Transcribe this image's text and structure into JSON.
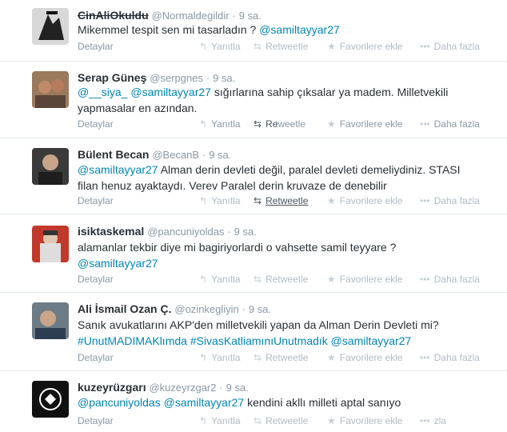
{
  "actions": {
    "details": "Detaylar",
    "reply": "Yanıtla",
    "retweet": "Retweetle",
    "favorite": "Favorilere ekle",
    "more": "Daha fazla",
    "retweet_partial": "Re",
    "more_partial": "zla"
  },
  "tweets": [
    {
      "fullname": "CinAliOkuldu",
      "username": "@Normaldegildir",
      "time": "9 sa.",
      "text_parts": [
        "Mikemmel tespit sen mi tasarladın ? ",
        "@samiltayyar27"
      ]
    },
    {
      "fullname": "Serap Güneş",
      "username": "@serpgnes",
      "time": "9 sa.",
      "text_parts": [
        "@__siya_ @samiltayyar27",
        " sığırlarına sahip çıksalar ya madem. Milletvekili yapmasalar en azından."
      ]
    },
    {
      "fullname": "Bülent Becan",
      "username": "@BecanB",
      "time": "9 sa.",
      "text_parts": [
        "@samiltayyar27",
        " Alman derin devleti değil, paralel devleti demeliydiniz. STASI filan henuz ayaktaydı. Verev Paralel derin kruvaze de denebilir"
      ]
    },
    {
      "fullname": "isiktaskemal",
      "username": "@pancuniyoldas",
      "time": "9 sa.",
      "text_parts": [
        "alamanlar tekbir diye mi bagiriyorlardi o vahsette samil teyyare ?",
        "@samiltayyar27"
      ]
    },
    {
      "fullname": "Ali İsmail Ozan Ç.",
      "username": "@ozinkegliyin",
      "time": "9 sa.",
      "text_parts": [
        "Sanık avukatlarını AKP'den milletvekili yapan da Alman Derin Devleti mi?",
        "#UnutMADIMAKlımda #SivasKatliamınıUnutmadık @samiltayyar27"
      ]
    },
    {
      "fullname": "kuzeyrüzgarı",
      "username": "@kuzeyrzgar2",
      "time": "9 sa.",
      "text_parts": [
        "@pancuniyoldas @samiltayyar27",
        " kendini akllı milleti aptal sanıyo"
      ]
    }
  ]
}
